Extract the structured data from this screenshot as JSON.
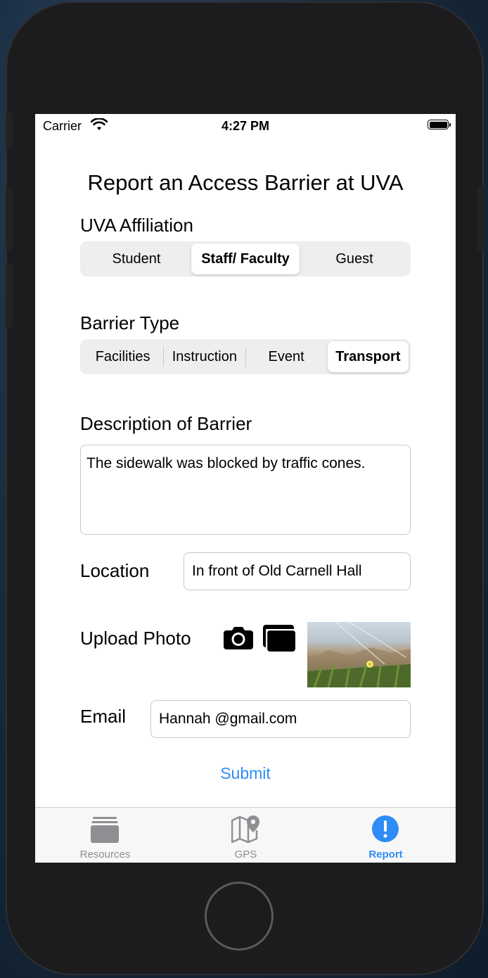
{
  "status_bar": {
    "carrier": "Carrier",
    "time": "4:27 PM"
  },
  "page": {
    "title": "Report an Access Barrier at UVA"
  },
  "affiliation": {
    "label": "UVA Affiliation",
    "options": [
      "Student",
      "Staff/ Faculty",
      "Guest"
    ],
    "selected": "Staff/ Faculty"
  },
  "barrier_type": {
    "label": "Barrier Type",
    "options": [
      "Facilities",
      "Instruction",
      "Event",
      "Transport"
    ],
    "selected": "Transport"
  },
  "description": {
    "label": "Description of Barrier",
    "value": "The sidewalk was blocked by traffic cones."
  },
  "location": {
    "label": "Location",
    "value": "In front of Old Carnell Hall"
  },
  "upload": {
    "label": "Upload Photo",
    "camera_icon": "camera-icon",
    "library_icon": "photo-library-icon"
  },
  "email": {
    "label": "Email",
    "value": "Hannah @gmail.com"
  },
  "submit_label": "Submit",
  "tabbar": {
    "tabs": [
      {
        "label": "Resources",
        "icon": "stack-icon",
        "active": false
      },
      {
        "label": "GPS",
        "icon": "map-pin-icon",
        "active": false
      },
      {
        "label": "Report",
        "icon": "exclamation-circle-icon",
        "active": true
      }
    ]
  },
  "colors": {
    "accent": "#2f8cf6",
    "tab_inactive": "#8e8e93",
    "segment_bg": "#eeeeef"
  }
}
